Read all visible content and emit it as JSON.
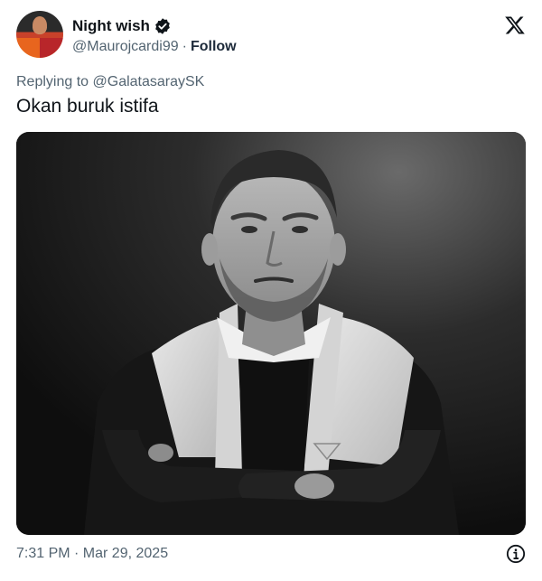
{
  "author": {
    "display_name": "Night wish",
    "handle": "@Maurojcardi99",
    "separator": "·",
    "follow_label": "Follow",
    "verified": true
  },
  "reply": {
    "prefix": "Replying to",
    "mention": "@GalatasaraySK"
  },
  "tweet": {
    "text": "Okan buruk istifa"
  },
  "footer": {
    "timestamp": "7:31 PM · Mar 29, 2025"
  },
  "icons": {
    "brand": "x-logo-icon",
    "verified": "verified-badge-icon",
    "info": "info-icon"
  },
  "colors": {
    "text_primary": "#0f1419",
    "text_secondary": "#536471",
    "photo": "grayscale"
  }
}
